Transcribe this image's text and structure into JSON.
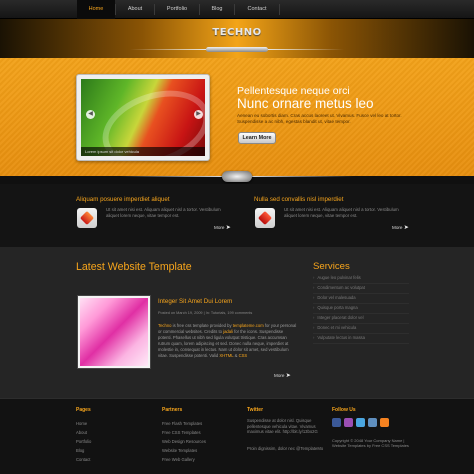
{
  "nav": {
    "items": [
      {
        "label": "Home",
        "active": true
      },
      {
        "label": "About",
        "active": false
      },
      {
        "label": "Portfolio",
        "active": false
      },
      {
        "label": "Blog",
        "active": false
      },
      {
        "label": "Contact",
        "active": false
      }
    ]
  },
  "header": {
    "logo": "TECHNO"
  },
  "hero": {
    "kicker": "Pellentesque neque orci",
    "title": "Nunc ornare metus leo",
    "intro": "Aenean eu sobortis diam. Cras accus laoreet ut. Vivamus. Fusce vel leo at tortor. Suspendisse a ac nibh, egestas blandit ut, vitae tempor.",
    "button": "Learn More",
    "slide_caption": "Lorem ipsum sit dolor vehicula"
  },
  "features": [
    {
      "title": "Aliquam posuere imperdiet aliquet",
      "text": "Ut sit amet nisi est. Aliquam aliquet nisl a tortor. Vestibulum aliquet lorem neque, vitae tempor est.",
      "more": "More"
    },
    {
      "title": "Nulla sed convallis nisl imperdiet",
      "text": "Ut sit amet nisi est. Aliquam aliquet nisl a tortor. Vestibulum aliquet lorem neque, vitae tempor est.",
      "more": "More"
    }
  ],
  "main": {
    "title": "Latest Website Template",
    "post": {
      "title": "Integer Sit Amet Dui Lorem",
      "meta": "Posted on March 19, 2009 | In: Tutorials, 199 comments",
      "body_pre": "Techno",
      "body_mid": " is free css template provided by ",
      "link1": "templateme.com",
      "body_2": " for your personal or commercial websites. Credits to ",
      "link2": "jadali",
      "body_3": " for the icons. Suspendisse potenti. Phasellus ut nibh sed ligula volutpat tristique. Cras accumsan rutrum quam, lorem adipiscing et sed. Donec nulla neque, imperdiet at molestie in, consequat in lectus. Nam ut dolor sit amet, sed vestibulum vitae. Suspendisse potenti. Valid ",
      "link3": "XHTML",
      "body_4": " & ",
      "link4": "CSS",
      "more": "More"
    },
    "services": {
      "title": "Services",
      "items": [
        "Augue leo pulvinar felis",
        "Condimentum ac volutpat",
        "Dolor vel malesuada",
        "Quisque porta magna",
        "Integer placerat dolor vel",
        "Donec et mi vehicula",
        "Vulputate lectus in massa"
      ]
    }
  },
  "footer": {
    "pages": {
      "title": "Pages",
      "items": [
        "Home",
        "About",
        "Portfolio",
        "Blog",
        "Contact"
      ]
    },
    "partners": {
      "title": "Partners",
      "items": [
        "Free Flash Templates",
        "Free CSS Templates",
        "Web Design Resources",
        "Website Templates",
        "Free Web Gallery"
      ]
    },
    "twitter": {
      "title": "Twitter",
      "text": "Suspendisse at dolor nisl. Quisque pellentesque vehicula vitae. Vivamus maximus vitae elit. http://bit.ly/13bo2G",
      "text2": "Proin dignissim, dolor nec @TemplateMo"
    },
    "follow": {
      "title": "Follow Us",
      "copyright": "Copyright © 2048 Your Company Name | Website Templates by Free CSS Templates"
    }
  },
  "colors": {
    "accent": "#f7a51c",
    "hero": "#f3a21a",
    "dark": "#141414",
    "panel": "#252525"
  }
}
